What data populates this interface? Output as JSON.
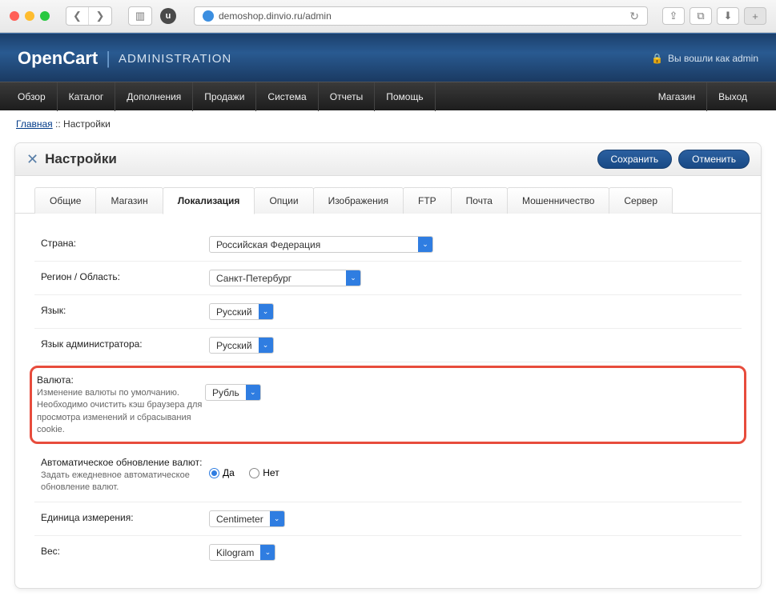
{
  "browser": {
    "url": "demoshop.dinvio.ru/admin",
    "uBadge": "u"
  },
  "header": {
    "brand": "OpenCart",
    "brandSub": "ADMINISTRATION",
    "loginStatus": "Вы вошли как admin"
  },
  "nav": {
    "left": [
      "Обзор",
      "Каталог",
      "Дополнения",
      "Продажи",
      "Система",
      "Отчеты",
      "Помощь"
    ],
    "right": [
      "Магазин",
      "Выход"
    ]
  },
  "breadcrumbs": {
    "home": "Главная",
    "sep": " :: ",
    "current": "Настройки"
  },
  "panel": {
    "title": "Настройки",
    "save": "Сохранить",
    "cancel": "Отменить"
  },
  "tabs": [
    "Общие",
    "Магазин",
    "Локализация",
    "Опции",
    "Изображения",
    "FTP",
    "Почта",
    "Мошенничество",
    "Сервер"
  ],
  "activeTab": "Локализация",
  "form": {
    "country": {
      "label": "Страна:",
      "value": "Российская Федерация"
    },
    "region": {
      "label": "Регион / Область:",
      "value": "Санкт-Петербург"
    },
    "language": {
      "label": "Язык:",
      "value": "Русский"
    },
    "adminLanguage": {
      "label": "Язык администратора:",
      "value": "Русский"
    },
    "currency": {
      "label": "Валюта:",
      "help": "Изменение валюты по умолчанию. Необходимо очистить кэш браузера для просмотра изменений и сбрасывания cookie.",
      "value": "Рубль"
    },
    "autoUpdate": {
      "label": "Автоматическое обновление валют:",
      "help": "Задать ежедневное автоматическое обновление валют.",
      "yes": "Да",
      "no": "Нет"
    },
    "lengthUnit": {
      "label": "Единица измерения:",
      "value": "Centimeter"
    },
    "weightUnit": {
      "label": "Вес:",
      "value": "Kilogram"
    }
  }
}
